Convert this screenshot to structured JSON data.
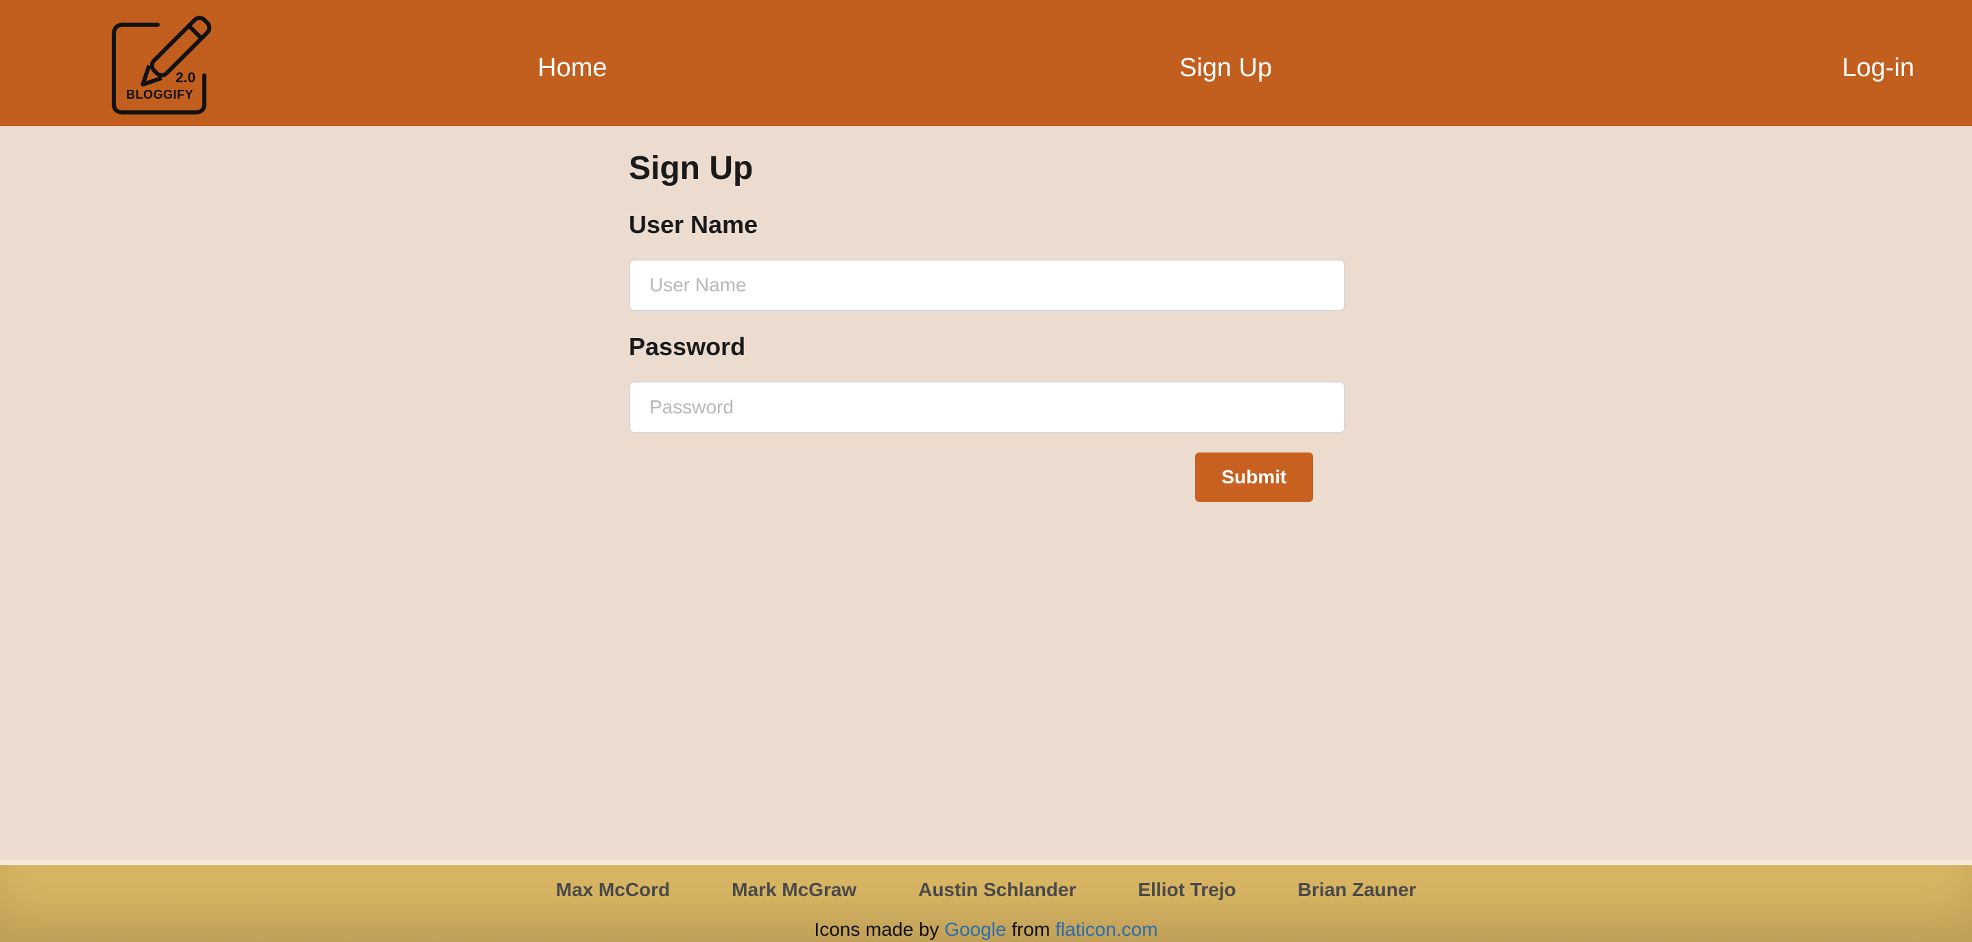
{
  "header": {
    "logo": {
      "version": "2.0",
      "name": "BLOGGIFY",
      "icon": "pencil-note-icon"
    },
    "nav": {
      "home": "Home",
      "signup": "Sign Up",
      "login": "Log-in"
    },
    "colors": {
      "background": "#c25e1e",
      "text": "#ffffff"
    }
  },
  "form": {
    "title": "Sign Up",
    "username": {
      "label": "User Name",
      "placeholder": "User Name",
      "value": ""
    },
    "password": {
      "label": "Password",
      "placeholder": "Password",
      "value": ""
    },
    "submit_label": "Submit",
    "accent": "#c8601f"
  },
  "footer": {
    "authors": [
      "Max McCord",
      "Mark McGraw",
      "Austin Schlander",
      "Elliot Trejo",
      "Brian Zauner"
    ],
    "credits": {
      "prefix": "Icons made by",
      "author_link": "Google",
      "middle": "from",
      "site_link": "flaticon.com"
    },
    "link_color": "#2b6cb0"
  },
  "page": {
    "background": "#ecdbcf"
  }
}
